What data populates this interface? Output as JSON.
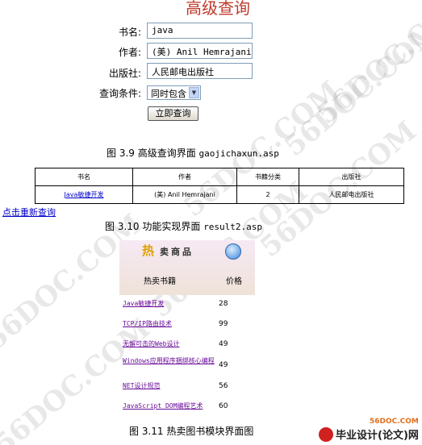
{
  "form": {
    "title": "高级查询",
    "fields": [
      {
        "label": "书名:",
        "value": "java"
      },
      {
        "label": "作者:",
        "value": "(美) Anil Hemrajani"
      },
      {
        "label": "出版社:",
        "value": "人民邮电出版社"
      },
      {
        "label": "查询条件:",
        "value": "同时包含"
      }
    ],
    "submit_label": "立即查询"
  },
  "captions": {
    "fig39_label": "图 3.9  高级查询界面",
    "fig39_file": "gaojichaxun.asp",
    "fig310_label": "图 3.10  功能实现界面",
    "fig310_file": "result2.asp",
    "fig311_label": "图 3.11  热卖图书模块界面图"
  },
  "result_table": {
    "headers": [
      "书名",
      "作者",
      "书籍分类",
      "出版社"
    ],
    "row": [
      "Java敏捷开发",
      "(美) Anil Hemrajani",
      "2",
      "人民邮电出版社"
    ]
  },
  "research_link": "点击重新查询",
  "hot": {
    "title_char": "热",
    "title_rest": "卖商品",
    "col_book": "热卖书籍",
    "col_price": "价格",
    "items": [
      {
        "name": "Java敏捷开发",
        "price": "28"
      },
      {
        "name": "TCP/IP路由技术",
        "price": "99"
      },
      {
        "name": "无懈可击的Web设计",
        "price": "49"
      },
      {
        "name": "Windows应用程序捆绑核心编程",
        "price": "49"
      },
      {
        "name": "NET设计规范",
        "price": "56"
      },
      {
        "name": "JavaScript DOM编程艺术",
        "price": "60"
      }
    ]
  },
  "watermark": "56DOC.COM",
  "logos": {
    "small": "56DOC.COM",
    "main": "毕业设计(论文)网"
  },
  "colors": {
    "title": "#c0392b",
    "link": "#0000cc",
    "hot_link": "#6a0a9a",
    "hot_accent": "#e0a000"
  }
}
